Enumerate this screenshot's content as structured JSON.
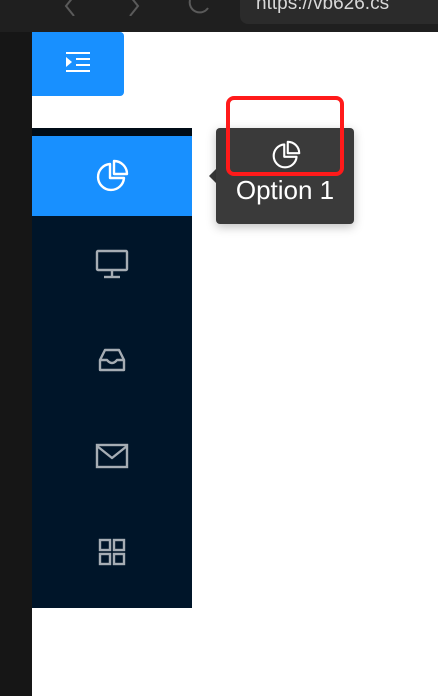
{
  "browser": {
    "url": "https://vb626.cs"
  },
  "toolbar": {
    "toggle_icon": "menu-fold-icon"
  },
  "menu": {
    "items": [
      {
        "icon": "pie-chart-icon",
        "selected": true
      },
      {
        "icon": "desktop-icon",
        "selected": false
      },
      {
        "icon": "inbox-icon",
        "selected": false
      },
      {
        "icon": "mail-icon",
        "selected": false
      },
      {
        "icon": "appstore-icon",
        "selected": false
      }
    ]
  },
  "tooltip": {
    "icon": "pie-chart-icon",
    "label": "Option 1"
  },
  "colors": {
    "primary": "#1890ff",
    "sider": "#001529",
    "tooltip_bg": "#3a3a3a",
    "annotation": "#ff1a1a"
  }
}
